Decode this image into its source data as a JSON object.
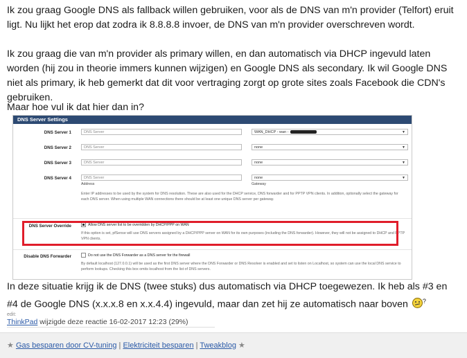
{
  "post": {
    "p1": "Ik zou graag Google DNS als fallback willen gebruiken, voor als de DNS van m'n provider (Telfort) eruit ligt. Nu lijkt het erop dat zodra ik 8.8.8.8 invoer, de DNS van m'n provider overschreven wordt.",
    "p2": "Ik zou graag die van m'n provider als primary willen, en dan automatisch via DHCP ingevuld laten worden (hij zou in theorie immers kunnen wijzigen) en Google DNS als secondary. Ik wil Google DNS niet als primary, ik heb gemerkt dat dit voor vertraging zorgt op grote sites zoals Facebook die CDN's gebruiken.",
    "p3": "Maar hoe vul ik dat hier dan in?",
    "p4": "In deze situatie krijg ik de DNS (twee stuks) dus automatisch via DHCP toegewezen. Ik heb als #3 en #4 de Google DNS (x.x.x.8 en x.x.4.4) ingevuld, maar dan zet hij ze automatisch naar boven",
    "p4_sup": "?"
  },
  "panel": {
    "title": "DNS Server Settings",
    "servers": [
      {
        "label": "DNS Server 1",
        "placeholder": "DNS Server",
        "gateway": "WAN_DHCP - wan -"
      },
      {
        "label": "DNS Server 2",
        "placeholder": "DNS Server",
        "gateway": "none"
      },
      {
        "label": "DNS Server 3",
        "placeholder": "DNS Server",
        "gateway": "none"
      },
      {
        "label": "DNS Server 4",
        "placeholder": "DNS Server",
        "gateway": "none"
      }
    ],
    "address_label": "Address",
    "gateway_label": "Gateway",
    "help_dns": "Enter IP addresses to be used by the system for DNS resolution. These are also used for the DHCP service, DNS forwarder and for PPTP VPN clients. In addition, optionally select the gateway for each DNS server. When using multiple WAN connections there should be at least one unique DNS server per gateway.",
    "override_label": "DNS Server Override",
    "override_check": "Allow DNS server list to be overridden by DHCP/PPP on WAN",
    "override_help": "If this option is set, pfSense will use DNS servers assigned by a DHCP/PPP server on WAN for its own purposes (including the DNS forwarder). However, they will not be assigned to DHCP and PPTP VPN clients.",
    "forwarder_label": "Disable DNS Forwarder",
    "forwarder_check": "Do not use the DNS Forwarder as a DNS server for the firewall",
    "forwarder_help": "By default localhost (127.0.0.1) will be used as the first DNS server where the DNS Forwarder or DNS Resolver is enabled and set to listen on Localhost, so system can use the local DNS service to perform lookups. Checking this box omits localhost from the list of DNS servers."
  },
  "edit": {
    "label": "edit:",
    "user": "ThinkPad",
    "text": " wijzigde deze reactie 16-02-2017 12:23 (29%)"
  },
  "signature": {
    "star": "★",
    "link1": "Gas besparen door CV-tuning",
    "sep": "|",
    "link2": "Elektriciteit besparen",
    "link3": "Tweakblog"
  }
}
